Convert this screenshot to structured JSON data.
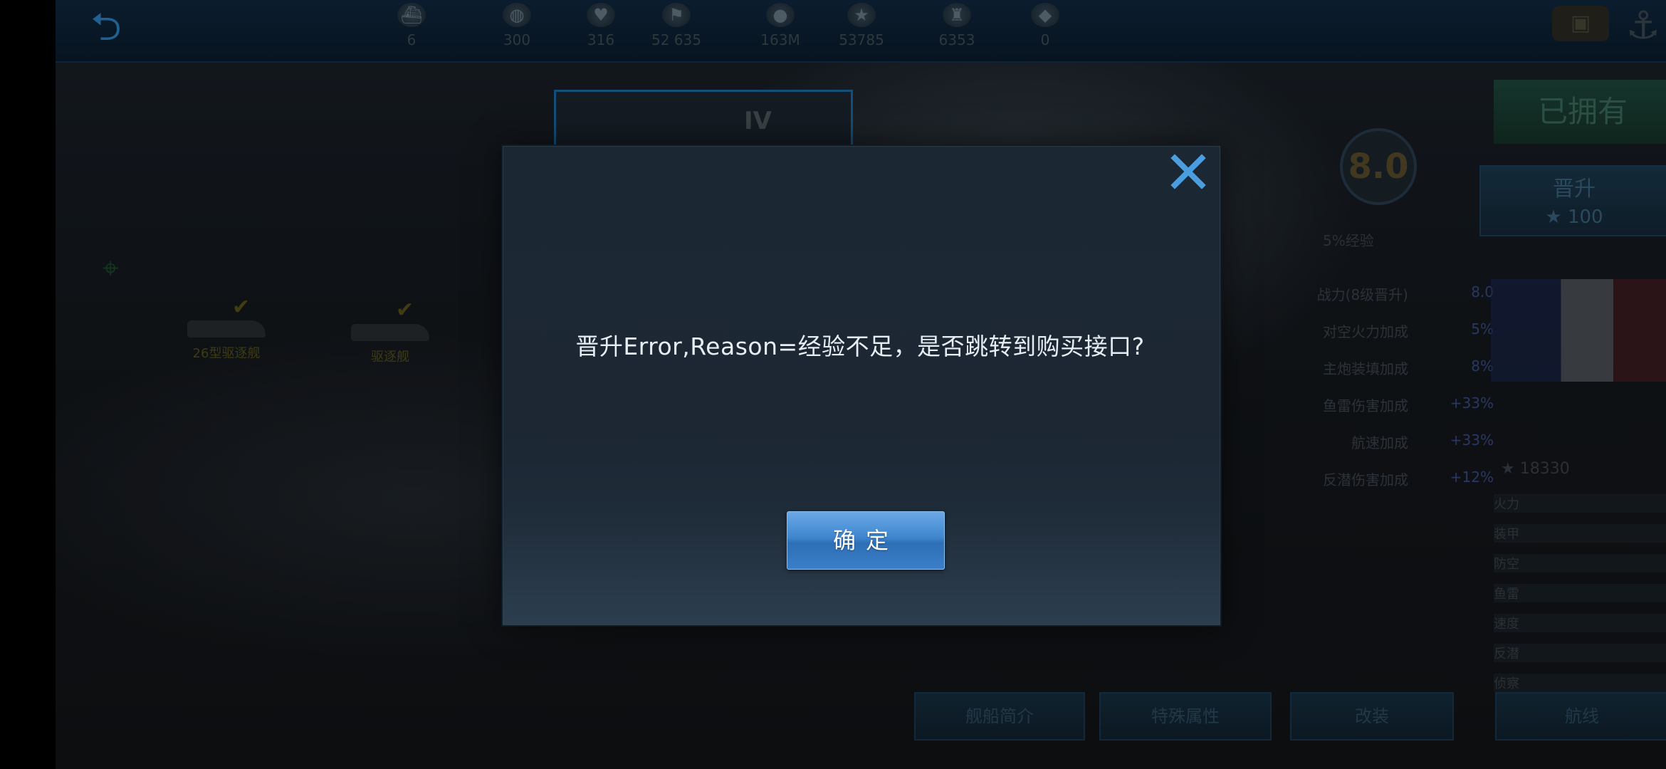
{
  "topbar": {
    "resources": [
      {
        "icon": "ship-icon",
        "value": "6"
      },
      {
        "icon": "globe-icon",
        "value": "300"
      },
      {
        "icon": "heart-icon",
        "value": "316"
      },
      {
        "icon": "flag-icon",
        "value": "52 635"
      },
      {
        "icon": "coin-icon",
        "value": "163M"
      },
      {
        "icon": "star-icon",
        "value": "53785"
      },
      {
        "icon": "trophy-icon",
        "value": "6353"
      },
      {
        "icon": "gem-icon",
        "value": "0"
      }
    ]
  },
  "background": {
    "tier": "IV",
    "rating": "8.0",
    "rating_caption": "5%经验",
    "owned_label": "已拥有",
    "upgrade_label": "晋升",
    "upgrade_cost": "★ 100",
    "stats": [
      {
        "label": "战力(8级晋升)",
        "value": "8.0"
      },
      {
        "label": "对空火力加成",
        "value": "5%"
      },
      {
        "label": "主炮装填加成",
        "value": "8%"
      },
      {
        "label": "鱼雷伤害加成",
        "value": "+33%"
      },
      {
        "label": "航速加成",
        "value": "+33%"
      },
      {
        "label": "反潜伤害加成",
        "value": "+12%"
      }
    ],
    "ships": [
      {
        "label": "26型驱逐舰",
        "check": "✔"
      },
      {
        "label": "驱逐舰",
        "check": "✔"
      }
    ],
    "side_score": "★ 18330",
    "side_rows": [
      "火力",
      "装甲",
      "防空",
      "鱼雷",
      "速度",
      "反潜",
      "侦察"
    ],
    "bottom_buttons": [
      "舰船简介",
      "特殊属性",
      "改装"
    ],
    "bottom_right_button": "航线"
  },
  "dialog": {
    "message": "晋升Error,Reason=经验不足，是否跳转到购买接口?",
    "confirm_label": "确定",
    "close_icon": "close-icon",
    "accent": "#4a9ee0"
  }
}
